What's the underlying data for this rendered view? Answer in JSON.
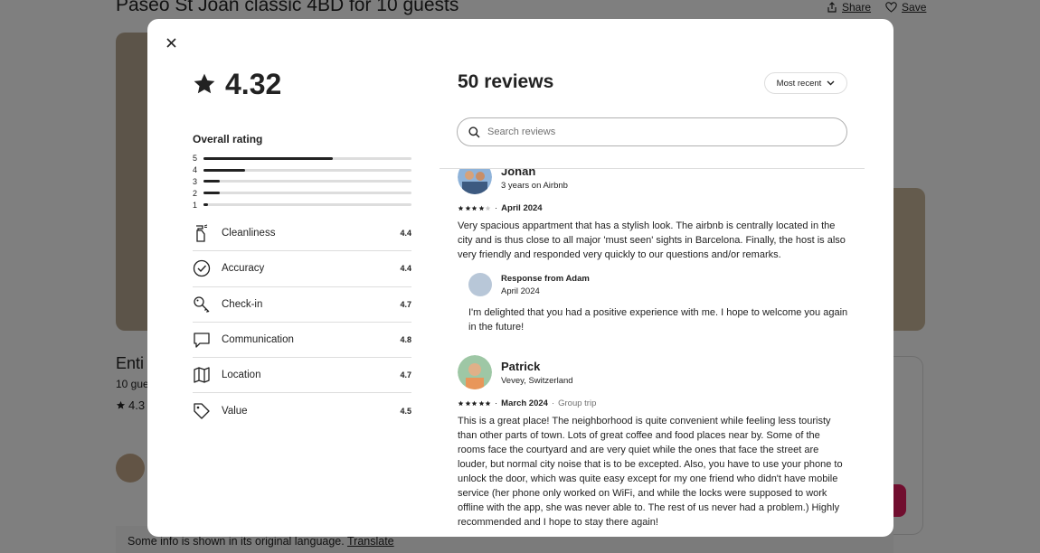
{
  "background": {
    "listing_title": "Paseo St Joan classic 4BD for 10 guests",
    "share_label": "Share",
    "save_label": "Save",
    "heading_partial": "Enti",
    "guests_partial": "10 gue",
    "rating_partial": "4.3",
    "footer_text": "Some info is shown in its original language.",
    "translate_label": "Translate"
  },
  "summary": {
    "rating": "4.32",
    "overall_label": "Overall rating",
    "distribution": [
      {
        "stars": "5",
        "fraction": 0.62
      },
      {
        "stars": "4",
        "fraction": 0.2
      },
      {
        "stars": "3",
        "fraction": 0.08
      },
      {
        "stars": "2",
        "fraction": 0.08
      },
      {
        "stars": "1",
        "fraction": 0.02
      }
    ],
    "categories": [
      {
        "icon": "spray-bottle-icon",
        "label": "Cleanliness",
        "value": "4.4"
      },
      {
        "icon": "check-circle-icon",
        "label": "Accuracy",
        "value": "4.4"
      },
      {
        "icon": "key-icon",
        "label": "Check-in",
        "value": "4.7"
      },
      {
        "icon": "chat-bubble-icon",
        "label": "Communication",
        "value": "4.8"
      },
      {
        "icon": "map-icon",
        "label": "Location",
        "value": "4.7"
      },
      {
        "icon": "tag-icon",
        "label": "Value",
        "value": "4.5"
      }
    ]
  },
  "reviews_panel": {
    "title": "50 reviews",
    "sort_label": "Most recent",
    "search_placeholder": "Search reviews"
  },
  "reviews": [
    {
      "name": "Johan",
      "meta": "3 years on Airbnb",
      "stars": 4,
      "date": "April 2024",
      "trip": "",
      "text": "Very spacious appartment that has a stylish look. The airbnb is centrally located in the city and is thus close to all major 'must seen' sights in Barcelona. Finally, the host is also very friendly and responded very quickly to our questions and/or remarks.",
      "response": {
        "title": "Response from Adam",
        "date": "April 2024",
        "text": "I'm delighted that you had a positive experience with me. I hope to welcome you again in the future!"
      }
    },
    {
      "name": "Patrick",
      "meta": "Vevey, Switzerland",
      "stars": 5,
      "date": "March 2024",
      "trip": "Group trip",
      "text": "This is a great place! The neighborhood is quite convenient while feeling less touristy than other parts of town. Lots of great coffee and food places near by. Some of the rooms face the courtyard and are very quiet while the ones that face the street are louder, but normal city noise that is to be excepted. Also, you have to use your phone to unlock the door, which was quite easy except for my one friend who didn't have mobile service (her phone only worked on WiFi, and while the locks were supposed to work offline with the app, she was never able to. The rest of us never had a problem.) Highly recommended and I hope to stay there again!"
    }
  ],
  "colors": {
    "text": "#222222",
    "muted": "#717171",
    "border": "#dddddd",
    "brand": "#e31c5f"
  }
}
